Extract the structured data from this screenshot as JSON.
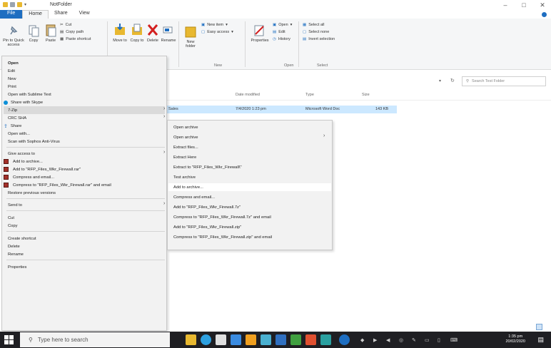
{
  "window": {
    "title": "NotFolder",
    "controls": [
      "minimize",
      "maximize",
      "close"
    ]
  },
  "ribbon_tabs": [
    {
      "label": "File",
      "active": false
    },
    {
      "label": "Home",
      "active": true
    },
    {
      "label": "Share",
      "active": false
    },
    {
      "label": "View",
      "active": false
    }
  ],
  "ribbon": {
    "pin_label": "Pin to Quick access",
    "copy_label": "Copy",
    "paste_label": "Paste",
    "cut_label": "Cut",
    "copy_path_label": "Copy path",
    "paste_shortcut_label": "Paste shortcut",
    "move_to_label": "Move to",
    "copy_to_label": "Copy to",
    "delete_label": "Delete",
    "rename_label": "Rename",
    "new_folder_label": "New folder",
    "new_item_label": "New item",
    "easy_access_label": "Easy access",
    "properties_label": "Properties",
    "open_label": "Open",
    "edit_label": "Edit",
    "history_label": "History",
    "select_all_label": "Select all",
    "select_none_label": "Select none",
    "invert_selection_label": "Invert selection",
    "group_new": "New",
    "group_open": "Open",
    "group_select": "Select"
  },
  "search": {
    "placeholder": "Search Test Folder"
  },
  "columns": {
    "date_modified": "Date modified",
    "type": "Type",
    "size": "Size"
  },
  "file_row": {
    "name": "Sales",
    "date": "7/4/2020 1:23 pm",
    "type": "Microsoft Word Doc",
    "size": "143 KB"
  },
  "context_menu": {
    "items": [
      {
        "label": "Open",
        "bold": true
      },
      {
        "label": "Edit"
      },
      {
        "label": "New"
      },
      {
        "label": "Print"
      },
      {
        "label": "Open with Sublime Text"
      },
      {
        "label": "Share with Skype"
      },
      {
        "label": "7-Zip"
      },
      {
        "label": "CRC SHA"
      },
      {
        "label": "Share"
      },
      {
        "label": "Open with..."
      },
      {
        "label": "Scan with Sophos Anti-Virus"
      },
      {
        "label": "Give access to"
      },
      {
        "label": "Add to archive..."
      },
      {
        "label": "Add to \"RFP_Files_Wkr_Firewall.rar\""
      },
      {
        "label": "Compress and email..."
      },
      {
        "label": "Compress to \"RFP_Files_Wkr_Firewall.rar\" and email"
      },
      {
        "label": "Restore previous versions"
      },
      {
        "label": "Send to"
      },
      {
        "label": "Cut"
      },
      {
        "label": "Copy"
      },
      {
        "label": "Create shortcut"
      },
      {
        "label": "Delete"
      },
      {
        "label": "Rename"
      },
      {
        "label": "Properties"
      }
    ]
  },
  "submenu": {
    "items": [
      {
        "label": "Open archive"
      },
      {
        "label": "Open archive"
      },
      {
        "label": "Extract files..."
      },
      {
        "label": "Extract Here"
      },
      {
        "label": "Extract to \"RFP_Files_Wkr_Firewall\\\""
      },
      {
        "label": "Test archive"
      },
      {
        "label": "Add to archive..."
      },
      {
        "label": "Compress and email..."
      },
      {
        "label": "Add to \"RFP_Files_Wkr_Firewall.7z\""
      },
      {
        "label": "Compress to \"RFP_Files_Wkr_Firewall.7z\" and email"
      },
      {
        "label": "Add to \"RFP_Files_Wkr_Firewall.zip\""
      },
      {
        "label": "Compress to \"RFP_Files_Wkr_Firewall.zip\" and email"
      }
    ]
  },
  "taskbar": {
    "search_placeholder": "Type here to search",
    "time": "1:35 pm",
    "date": "20/02/2020"
  },
  "colors": {
    "accent": "#1e6ec1",
    "menu_bg": "#f2f2f2",
    "selection": "#cce8ff",
    "taskbar": "#1f1f23"
  }
}
